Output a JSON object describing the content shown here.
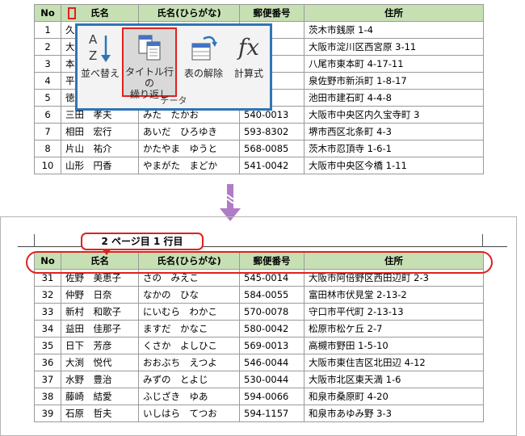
{
  "colors": {
    "header_fill": "#c6e0b4",
    "highlight": "#e02020",
    "ribbon_border": "#2e75b6"
  },
  "headers": {
    "no": "No",
    "name": "氏名",
    "kana": "氏名(ひらがな)",
    "zip": "郵便番号",
    "address": "住所"
  },
  "top_table": {
    "rows": [
      {
        "no": "1",
        "name": "久",
        "kana": "",
        "zip": "0087",
        "address": "茨木市銭原 1-4"
      },
      {
        "no": "2",
        "name": "大",
        "kana": "",
        "zip": "0004",
        "address": "大阪市淀川区西宮原 3-11"
      },
      {
        "no": "3",
        "name": "本",
        "kana": "",
        "zip": "0004",
        "address": "八尾市東本町 4-17-11"
      },
      {
        "no": "4",
        "name": "平",
        "kana": "",
        "zip": "0064",
        "address": "泉佐野市新浜町 1-8-17"
      },
      {
        "no": "5",
        "name": "徳",
        "kana": "",
        "zip": "0053",
        "address": "池田市建石町 4-4-8"
      },
      {
        "no": "6",
        "name": "三田　孝夫",
        "kana": "みた　たかお",
        "zip": "540-0013",
        "address": "大阪市中央区内久宝寺町 3"
      },
      {
        "no": "7",
        "name": "相田　宏行",
        "kana": "あいだ　ひろゆき",
        "zip": "593-8302",
        "address": "堺市西区北条町 4-3"
      },
      {
        "no": "8",
        "name": "片山　祐介",
        "kana": "かたやま　ゆうと",
        "zip": "568-0085",
        "address": "茨木市忍頂寺 1-6-1"
      },
      {
        "no": "10",
        "name": "山形　円香",
        "kana": "やまがた　まどか",
        "zip": "541-0042",
        "address": "大阪市中央区今橋 1-11"
      }
    ]
  },
  "ribbon": {
    "sort": "並べ替え",
    "print_titles_line1": "タイトル行の",
    "print_titles_line2": "繰り返し",
    "unpivot": "表の解除",
    "formula": "計算式",
    "formula_icon": "fx",
    "group": "データ"
  },
  "callout": "2 ページ目 1 行目",
  "bottom_table": {
    "rows": [
      {
        "no": "31",
        "name": "佐野　美恵子",
        "kana": "さの　みえこ",
        "zip": "545-0014",
        "address": "大阪市阿倍野区西田辺町 2-3"
      },
      {
        "no": "32",
        "name": "仲野　日奈",
        "kana": "なかの　ひな",
        "zip": "584-0055",
        "address": "富田林市伏見堂 2-13-2"
      },
      {
        "no": "33",
        "name": "新村　和歌子",
        "kana": "にいむら　わかこ",
        "zip": "570-0078",
        "address": "守口市平代町 2-13-13"
      },
      {
        "no": "34",
        "name": "益田　佳那子",
        "kana": "ますだ　かなこ",
        "zip": "580-0042",
        "address": "松原市松ケ丘 2-7"
      },
      {
        "no": "35",
        "name": "日下　芳彦",
        "kana": "くさか　よしひこ",
        "zip": "569-0013",
        "address": "高槻市野田 1-5-10"
      },
      {
        "no": "36",
        "name": "大渕　悦代",
        "kana": "おおぶち　えつよ",
        "zip": "546-0044",
        "address": "大阪市東住吉区北田辺 4-12"
      },
      {
        "no": "37",
        "name": "水野　豊治",
        "kana": "みずの　とよじ",
        "zip": "530-0044",
        "address": "大阪市北区東天満 1-6"
      },
      {
        "no": "38",
        "name": "藤崎　結愛",
        "kana": "ふじざき　ゆあ",
        "zip": "594-0066",
        "address": "和泉市桑原町 4-20"
      },
      {
        "no": "39",
        "name": "石原　哲夫",
        "kana": "いしはら　てつお",
        "zip": "594-1157",
        "address": "和泉市あゆみ野 3-3"
      }
    ]
  }
}
